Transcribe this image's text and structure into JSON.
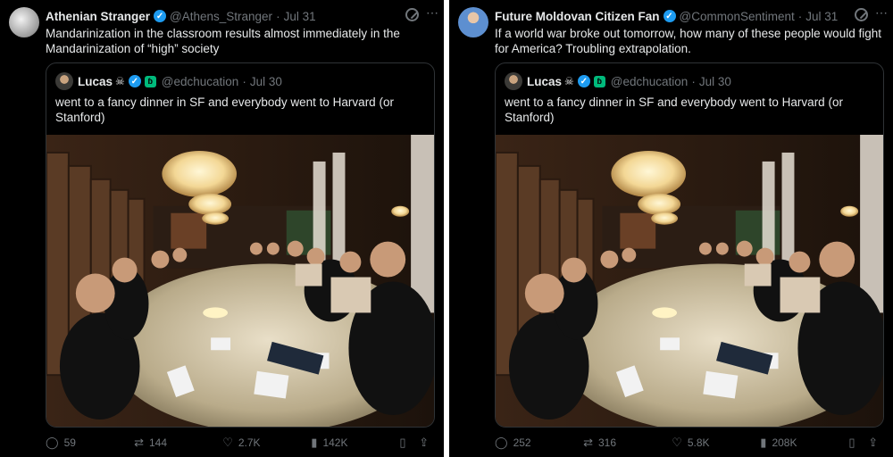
{
  "tweets": [
    {
      "author_name": "Athenian Stranger",
      "handle": "@Athens_Stranger",
      "date": "Jul 31",
      "text": "Mandarinization in the classroom results almost immediately in the Mandarinization of “high” society",
      "counts": {
        "replies": "59",
        "reposts": "144",
        "likes": "2.7K",
        "views": "142K"
      }
    },
    {
      "author_name": "Future Moldovan Citizen Fan",
      "handle": "@CommonSentiment",
      "date": "Jul 31",
      "text": "If a world war broke out tomorrow, how many of these people would fight for America? Troubling extrapolation.",
      "counts": {
        "replies": "252",
        "reposts": "316",
        "likes": "5.8K",
        "views": "208K"
      }
    }
  ],
  "quoted": {
    "author_name": "Lucas",
    "handle": "@edchucation",
    "date": "Jul 30",
    "text": "went to a fancy dinner in SF and everybody went to Harvard (or Stanford)"
  },
  "separator": "·",
  "icons": {
    "verified": "verified-badge-icon",
    "grok": "grok-icon",
    "more": "more-icon",
    "reply": "reply-icon",
    "repost": "repost-icon",
    "like": "heart-icon",
    "views": "views-icon",
    "bookmark": "bookmark-icon",
    "share": "share-icon"
  },
  "colors": {
    "background": "#000000",
    "text": "#e7e9ea",
    "muted": "#71767b",
    "verified": "#1d9bf0",
    "border": "#2f3336"
  }
}
